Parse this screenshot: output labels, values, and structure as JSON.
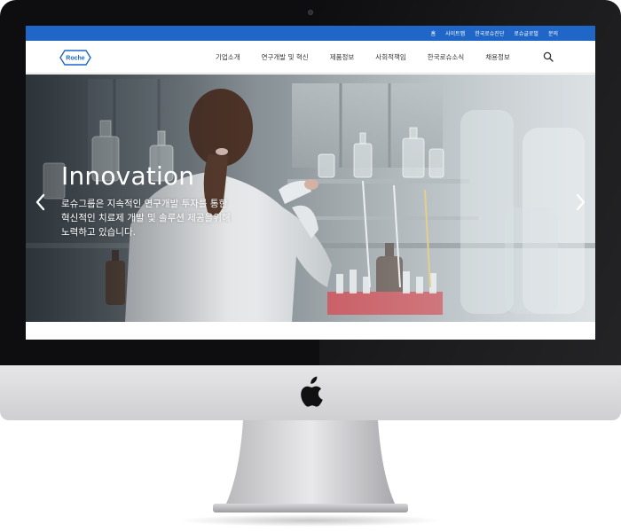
{
  "utility_links": [
    "홈",
    "사이트맵",
    "한국로슈진단",
    "로슈글로벌",
    "문의"
  ],
  "brand": {
    "logo_text": "Roche",
    "accent": "#1f66c6"
  },
  "nav_items": [
    "기업소개",
    "연구개발 및 혁신",
    "제품정보",
    "사회적책임",
    "한국로슈소식",
    "채용정보"
  ],
  "hero": {
    "title": "Innovation",
    "line1": "로슈그룹은 지속적인 연구개발 투자를 통한",
    "line2": "혁신적인 치료제 개발 및 솔루션 제공을위해",
    "line3": "노력하고 있습니다."
  },
  "icons": [
    "search-icon",
    "chevron-left-icon",
    "chevron-right-icon",
    "apple-logo-icon",
    "camera-icon"
  ]
}
